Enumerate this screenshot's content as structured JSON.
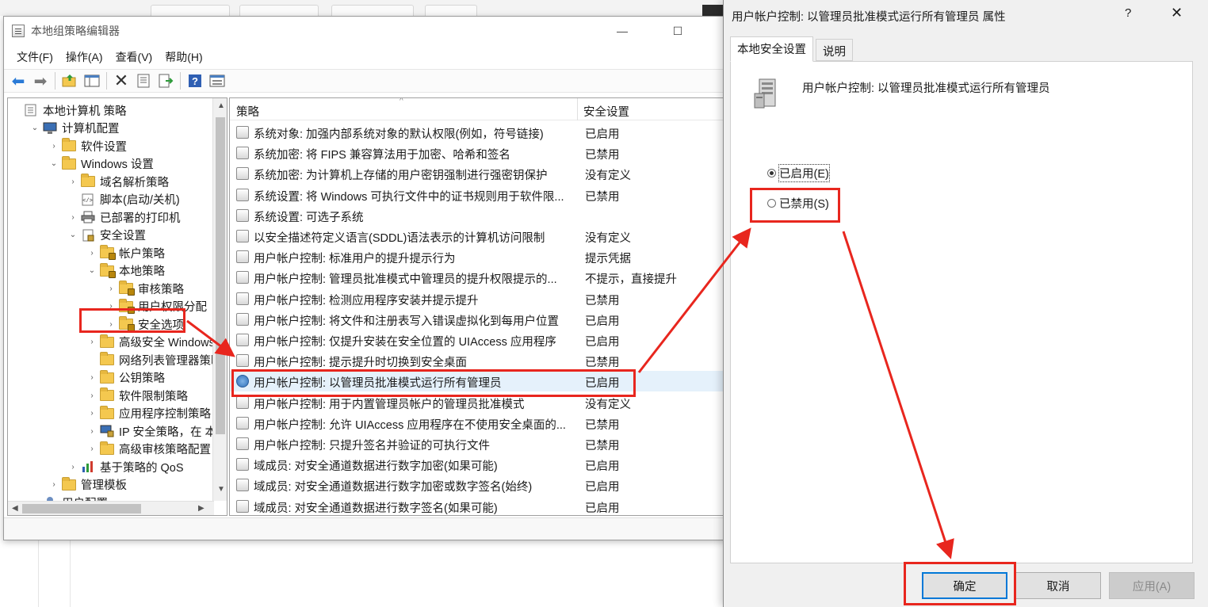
{
  "main_window": {
    "title": "本地组策略编辑器",
    "minimize_glyph": "—",
    "maximize_glyph": "☐"
  },
  "menu": [
    "文件(F)",
    "操作(A)",
    "查看(V)",
    "帮助(H)"
  ],
  "tree": [
    {
      "label": "本地计算机 策略",
      "level": 0,
      "expander": "",
      "icon": "policy-icon"
    },
    {
      "label": "计算机配置",
      "level": 1,
      "expander": "⌄",
      "icon": "computer-icon"
    },
    {
      "label": "软件设置",
      "level": 2,
      "expander": "›",
      "icon": "folder-icon"
    },
    {
      "label": "Windows 设置",
      "level": 2,
      "expander": "⌄",
      "icon": "folder-icon"
    },
    {
      "label": "域名解析策略",
      "level": 3,
      "expander": "›",
      "icon": "folder-icon"
    },
    {
      "label": "脚本(启动/关机)",
      "level": 3,
      "expander": "",
      "icon": "script-icon"
    },
    {
      "label": "已部署的打印机",
      "level": 3,
      "expander": "›",
      "icon": "printer-icon"
    },
    {
      "label": "安全设置",
      "level": 3,
      "expander": "⌄",
      "icon": "security-icon"
    },
    {
      "label": "帐户策略",
      "level": 4,
      "expander": "›",
      "icon": "folder-lock-icon"
    },
    {
      "label": "本地策略",
      "level": 4,
      "expander": "⌄",
      "icon": "folder-lock-icon"
    },
    {
      "label": "审核策略",
      "level": 5,
      "expander": "›",
      "icon": "folder-lock-icon"
    },
    {
      "label": "用户权限分配",
      "level": 5,
      "expander": "›",
      "icon": "folder-lock-icon"
    },
    {
      "label": "安全选项",
      "level": 5,
      "expander": "›",
      "icon": "folder-lock-icon"
    },
    {
      "label": "高级安全 Windows",
      "level": 4,
      "expander": "›",
      "icon": "folder-icon"
    },
    {
      "label": "网络列表管理器策略",
      "level": 4,
      "expander": "",
      "icon": "folder-icon"
    },
    {
      "label": "公钥策略",
      "level": 4,
      "expander": "›",
      "icon": "folder-icon"
    },
    {
      "label": "软件限制策略",
      "level": 4,
      "expander": "›",
      "icon": "folder-icon"
    },
    {
      "label": "应用程序控制策略",
      "level": 4,
      "expander": "›",
      "icon": "folder-icon"
    },
    {
      "label": "IP 安全策略，在 本地",
      "level": 4,
      "expander": "›",
      "icon": "ip-security-icon"
    },
    {
      "label": "高级审核策略配置",
      "level": 4,
      "expander": "›",
      "icon": "folder-icon"
    },
    {
      "label": "基于策略的 QoS",
      "level": 3,
      "expander": "›",
      "icon": "chart-icon"
    },
    {
      "label": "管理模板",
      "level": 2,
      "expander": "›",
      "icon": "folder-icon"
    },
    {
      "label": "用户配置",
      "level": 1,
      "expander": "",
      "icon": "user-icon"
    }
  ],
  "list": {
    "col_policy": "策略",
    "col_setting": "安全设置",
    "rows": [
      {
        "name": "系统对象: 加强内部系统对象的默认权限(例如，符号链接)",
        "value": "已启用"
      },
      {
        "name": "系统加密: 将 FIPS 兼容算法用于加密、哈希和签名",
        "value": "已禁用"
      },
      {
        "name": "系统加密: 为计算机上存储的用户密钥强制进行强密钥保护",
        "value": "没有定义"
      },
      {
        "name": "系统设置: 将 Windows 可执行文件中的证书规则用于软件限...",
        "value": "已禁用"
      },
      {
        "name": "系统设置: 可选子系统",
        "value": ""
      },
      {
        "name": "以安全描述符定义语言(SDDL)语法表示的计算机访问限制",
        "value": "没有定义"
      },
      {
        "name": "用户帐户控制: 标准用户的提升提示行为",
        "value": "提示凭据"
      },
      {
        "name": "用户帐户控制: 管理员批准模式中管理员的提升权限提示的...",
        "value": "不提示，直接提升"
      },
      {
        "name": "用户帐户控制: 检测应用程序安装并提示提升",
        "value": "已禁用"
      },
      {
        "name": "用户帐户控制: 将文件和注册表写入错误虚拟化到每用户位置",
        "value": "已启用"
      },
      {
        "name": "用户帐户控制: 仅提升安装在安全位置的 UIAccess 应用程序",
        "value": "已启用"
      },
      {
        "name": "用户帐户控制: 提示提升时切换到安全桌面",
        "value": "已禁用"
      },
      {
        "name": "用户帐户控制: 以管理员批准模式运行所有管理员",
        "value": "已启用"
      },
      {
        "name": "用户帐户控制: 用于内置管理员帐户的管理员批准模式",
        "value": "没有定义"
      },
      {
        "name": "用户帐户控制: 允许 UIAccess 应用程序在不使用安全桌面的...",
        "value": "已禁用"
      },
      {
        "name": "用户帐户控制: 只提升签名并验证的可执行文件",
        "value": "已禁用"
      },
      {
        "name": "域成员: 对安全通道数据进行数字加密(如果可能)",
        "value": "已启用"
      },
      {
        "name": "域成员: 对安全通道数据进行数字加密或数字签名(始终)",
        "value": "已启用"
      },
      {
        "name": "域成员: 对安全通道数据进行数字签名(如果可能)",
        "value": "已启用"
      }
    ]
  },
  "dialog": {
    "title": "用户帐户控制: 以管理员批准模式运行所有管理员 属性",
    "help_glyph": "?",
    "close_glyph": "✕",
    "tab_local": "本地安全设置",
    "tab_explain": "说明",
    "policy_name": "用户帐户控制: 以管理员批准模式运行所有管理员",
    "radio_enabled": "已启用(E)",
    "radio_disabled": "已禁用(S)",
    "btn_ok": "确定",
    "btn_cancel": "取消",
    "btn_apply": "应用(A)"
  },
  "colors": {
    "annotation_red": "#e8261e",
    "selection_blue": "#e5f1fb"
  }
}
